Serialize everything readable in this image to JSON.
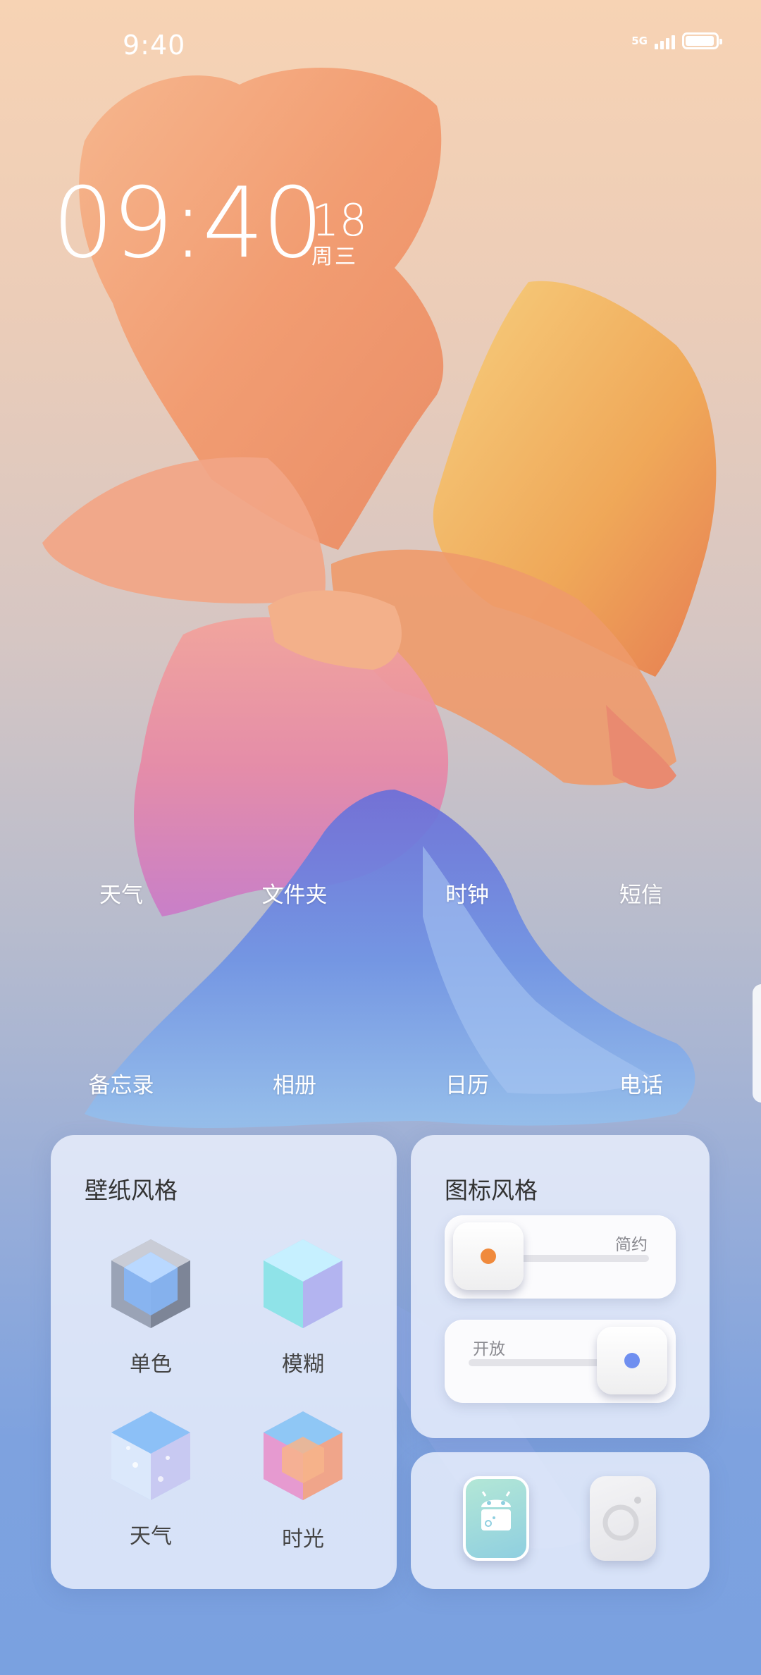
{
  "status_bar": {
    "time": "9:40",
    "network": "5G",
    "battery_level": 0.95
  },
  "clock": {
    "time": "09:40",
    "day": "18",
    "weekday": "周三"
  },
  "apps_row1": [
    "天气",
    "文件夹",
    "时钟",
    "短信"
  ],
  "apps_row2": [
    "备忘录",
    "相册",
    "日历",
    "电话"
  ],
  "wallpaper_card": {
    "title": "壁纸风格",
    "options": [
      {
        "label": "单色",
        "icon": "mono-cube-icon"
      },
      {
        "label": "模糊",
        "icon": "blur-cube-icon"
      },
      {
        "label": "天气",
        "icon": "weather-cube-icon"
      },
      {
        "label": "时光",
        "icon": "time-cube-icon"
      }
    ]
  },
  "icon_style_card": {
    "title": "图标风格",
    "simple_label": "简约",
    "open_label": "开放",
    "simple_dot_color": "#f08a3c",
    "open_dot_color": "#6f8ff0"
  },
  "icon_preview_card": {
    "icons": [
      "android-icon",
      "camera-icon"
    ]
  }
}
